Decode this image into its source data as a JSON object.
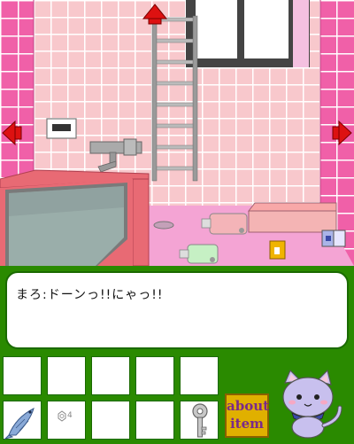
{
  "game": {
    "scene": "bathroom",
    "dialog": "まろ:ドーンっ!!にゃっ!!",
    "nav": {
      "up_icon": "red-arrow-up-icon",
      "left_icon": "red-arrow-left-icon",
      "right_icon": "red-arrow-right-icon"
    },
    "colors": {
      "wall_tile": "#f8c8cc",
      "wall_tile_grout": "#ffffff",
      "side_tile": "#f060a8",
      "floor": "#f4a4d4",
      "bathtub": "#e86a74",
      "panel_green": "#2a8a00",
      "arrow_red": "#dd1111",
      "about_button": "#e0b000"
    }
  },
  "inventory": {
    "slots": [
      {
        "item": ""
      },
      {
        "item": ""
      },
      {
        "item": ""
      },
      {
        "item": ""
      },
      {
        "item": ""
      },
      {
        "item": "fish-icon"
      },
      {
        "item": "hex-nut-icon",
        "count": "4"
      },
      {
        "item": ""
      },
      {
        "item": ""
      },
      {
        "item": "key-icon"
      }
    ]
  },
  "about": {
    "label": "about\nitem"
  },
  "mascot": {
    "icon": "cat-mascot-icon"
  }
}
